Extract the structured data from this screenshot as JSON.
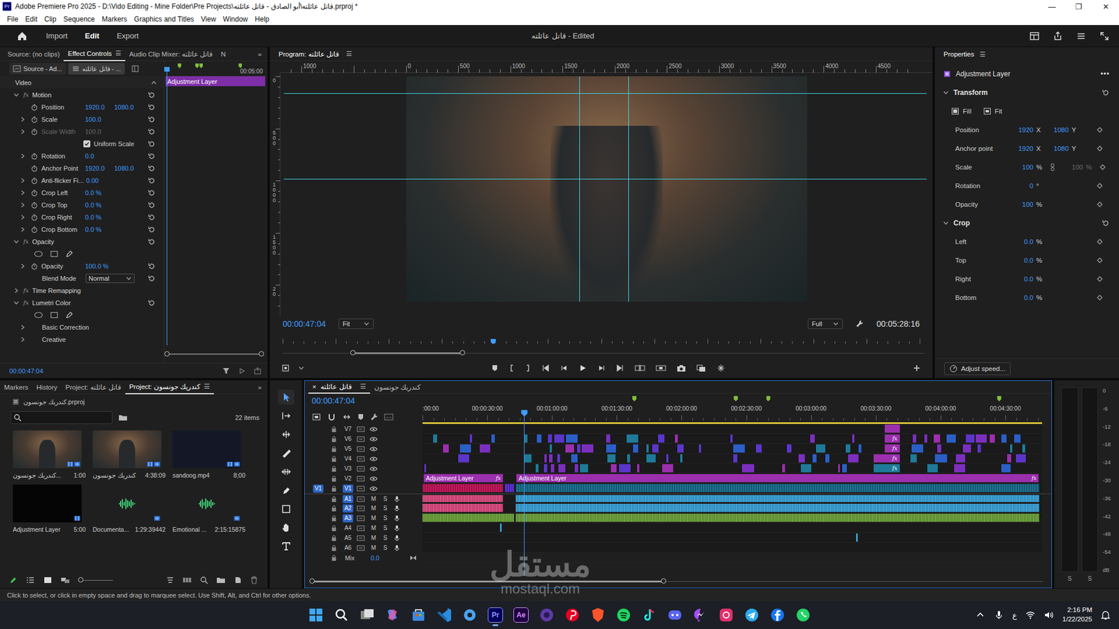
{
  "window": {
    "app_glyph": "Pr",
    "title": "Adobe Premiere Pro 2025 - D:\\Vido Editing - Mine Folder\\Pre Projects\\قاتل عائلته\\أبو الصادق - قاتل عائلته.prproj *",
    "controls": [
      "—",
      "❐",
      "✕"
    ]
  },
  "menu": [
    "File",
    "Edit",
    "Clip",
    "Sequence",
    "Markers",
    "Graphics and Titles",
    "View",
    "Window",
    "Help"
  ],
  "header": {
    "nav": [
      {
        "label": "Import",
        "selected": false
      },
      {
        "label": "Edit",
        "selected": true
      },
      {
        "label": "Export",
        "selected": false
      }
    ],
    "title": "قاتل عائلته - Edited"
  },
  "effect_controls": {
    "tabs": [
      {
        "label": "Source: (no clips)",
        "selected": false
      },
      {
        "label": "Effect Controls",
        "selected": true
      },
      {
        "label": "Audio Clip Mixer: قاتل عائلته",
        "selected": false
      },
      {
        "label": "N",
        "selected": false
      }
    ],
    "tab_menu": "☰",
    "overflow": "»",
    "source": "Source - Ad...",
    "clip": "قاتل عائلته - ...",
    "ruler_time": "00:05:00",
    "clip_label": "Adjustment Layer",
    "markers": [
      0.13,
      0.3,
      0.34,
      0.72
    ],
    "playhead": 0.02,
    "section": "Video",
    "rows": [
      {
        "kind": "group",
        "label": "Motion",
        "fx": "fx",
        "expanded": true,
        "reset": true
      },
      {
        "kind": "param",
        "label": "Position",
        "values": [
          "1920.0",
          "1080.0"
        ],
        "expandable": false,
        "disabled": false,
        "reset": true
      },
      {
        "kind": "param",
        "label": "Scale",
        "values": [
          "100.0"
        ],
        "expandable": true,
        "disabled": false,
        "reset": true
      },
      {
        "kind": "param",
        "label": "Scale Width",
        "values": [
          "100.0"
        ],
        "expandable": true,
        "disabled": true,
        "reset": true
      },
      {
        "kind": "check",
        "label": "Uniform Scale",
        "checked": true,
        "reset": true
      },
      {
        "kind": "param",
        "label": "Rotation",
        "values": [
          "0.0"
        ],
        "expandable": true,
        "disabled": false,
        "reset": true
      },
      {
        "kind": "param",
        "label": "Anchor Point",
        "values": [
          "1920.0",
          "1080.0"
        ],
        "expandable": false,
        "disabled": false,
        "reset": true
      },
      {
        "kind": "param",
        "label": "Anti-flicker Fi...",
        "values": [
          "0.00"
        ],
        "expandable": true,
        "disabled": false,
        "reset": true
      },
      {
        "kind": "param",
        "label": "Crop Left",
        "values": [
          "0.0 %"
        ],
        "expandable": true,
        "disabled": false,
        "reset": true
      },
      {
        "kind": "param",
        "label": "Crop Top",
        "values": [
          "0.0 %"
        ],
        "expandable": true,
        "disabled": false,
        "reset": true
      },
      {
        "kind": "param",
        "label": "Crop Right",
        "values": [
          "0.0 %"
        ],
        "expandable": true,
        "disabled": false,
        "reset": true
      },
      {
        "kind": "param",
        "label": "Crop Bottom",
        "values": [
          "0.0 %"
        ],
        "expandable": true,
        "disabled": false,
        "reset": true
      },
      {
        "kind": "group",
        "label": "Opacity",
        "fx": "fx",
        "expanded": true,
        "reset": true
      },
      {
        "kind": "masks"
      },
      {
        "kind": "param",
        "label": "Opacity",
        "values": [
          "100.0 %"
        ],
        "expandable": true,
        "disabled": false,
        "reset": true
      },
      {
        "kind": "select",
        "label": "Blend Mode",
        "value": "Normal",
        "reset": true
      },
      {
        "kind": "group",
        "label": "Time Remapping",
        "fx": "fx",
        "expanded": false,
        "reset": false
      },
      {
        "kind": "group",
        "label": "Lumetri Color",
        "fx": "fx",
        "expanded": true,
        "reset": true
      },
      {
        "kind": "masks"
      },
      {
        "kind": "sub",
        "label": "Basic Correction",
        "expanded": false
      },
      {
        "kind": "sub",
        "label": "Creative",
        "expanded": false
      }
    ],
    "timecode": "00:00:47:04"
  },
  "program": {
    "title": "Program: قاتل عائلته",
    "menu": "☰",
    "ruler_h": [
      {
        "label": "1000",
        "value": -1000
      },
      {
        "label": "0",
        "value": 0
      },
      {
        "label": "500",
        "value": 500
      },
      {
        "label": "1000",
        "value": 1000
      },
      {
        "label": "1500",
        "value": 1500
      },
      {
        "label": "2000",
        "value": 2000
      },
      {
        "label": "2500",
        "value": 2500
      },
      {
        "label": "3000",
        "value": 3000
      },
      {
        "label": "3500",
        "value": 3500
      },
      {
        "label": "4000",
        "value": 4000
      },
      {
        "label": "4500",
        "value": 4500
      }
    ],
    "ruler_v": [
      {
        "label": "0",
        "value": 0
      },
      {
        "label": "500",
        "value": 500
      },
      {
        "label": "1000",
        "value": 1000
      },
      {
        "label": "1500",
        "value": 1500
      },
      {
        "label": "20",
        "value": 2000
      }
    ],
    "guides_h": [
      164,
      984
    ],
    "guides_v": [
      1660,
      2132
    ],
    "timecode": "00:00:47:04",
    "fit": "Fit",
    "quality": "Full",
    "duration": "00:05:28:16",
    "playhead": 0.33,
    "zoom_start": 0.11,
    "zoom_end": 0.28
  },
  "properties": {
    "title": "Properties",
    "menu": "☰",
    "item": "Adjustment Layer",
    "more": "•••",
    "sections": [
      {
        "title": "Transform",
        "expanded": true,
        "buttons": [
          "Fill",
          "Fit"
        ],
        "rows": [
          {
            "label": "Position",
            "values": [
              {
                "value": "1920",
                "unit": "X",
                "disabled": false
              },
              {
                "value": "1080",
                "unit": "Y",
                "disabled": false
              }
            ],
            "linked": false
          },
          {
            "label": "Anchor point",
            "values": [
              {
                "value": "1920",
                "unit": "X",
                "disabled": false
              },
              {
                "value": "1080",
                "unit": "Y",
                "disabled": false
              }
            ],
            "linked": false
          },
          {
            "label": "Scale",
            "values": [
              {
                "value": "100",
                "unit": "%",
                "disabled": false
              },
              {
                "value": "100",
                "unit": "%",
                "disabled": true
              }
            ],
            "linked": true
          },
          {
            "label": "Rotation",
            "values": [
              {
                "value": "0",
                "unit": "°",
                "disabled": false
              }
            ],
            "linked": false
          },
          {
            "label": "Opacity",
            "values": [
              {
                "value": "100",
                "unit": "%",
                "disabled": false
              }
            ],
            "linked": false
          }
        ]
      },
      {
        "title": "Crop",
        "expanded": true,
        "buttons": [],
        "rows": [
          {
            "label": "Left",
            "values": [
              {
                "value": "0.0",
                "unit": "%",
                "disabled": false
              }
            ],
            "linked": false
          },
          {
            "label": "Top",
            "values": [
              {
                "value": "0.0",
                "unit": "%",
                "disabled": false
              }
            ],
            "linked": false
          },
          {
            "label": "Right",
            "values": [
              {
                "value": "0.0",
                "unit": "%",
                "disabled": false
              }
            ],
            "linked": false
          },
          {
            "label": "Bottom",
            "values": [
              {
                "value": "0.0",
                "unit": "%",
                "disabled": false
              }
            ],
            "linked": false
          }
        ]
      }
    ],
    "adjust": "Adjust speed..."
  },
  "project": {
    "tabs": [
      {
        "label": "Markers",
        "selected": false
      },
      {
        "label": "History",
        "selected": false
      },
      {
        "label": "Project: قاتل عائلته",
        "selected": false
      },
      {
        "label": "Project: كندريك جونسون",
        "selected": true
      }
    ],
    "menu": "☰",
    "overflow": "»",
    "file": "كندريك جونسون.prproj",
    "count": "22 items",
    "items": [
      {
        "name": "كندريك جونسون...",
        "duration": "1:00",
        "kind": "video"
      },
      {
        "name": "كندريك جونسون",
        "duration": "4:38:09",
        "kind": "video"
      },
      {
        "name": "sandoog.mp4",
        "duration": "8;00",
        "kind": "dark"
      },
      {
        "name": "Adjustment Layer",
        "duration": "5:00",
        "kind": "black"
      },
      {
        "name": "Documenta...",
        "duration": "1:29:39442",
        "kind": "audio"
      },
      {
        "name": "Emotional ...",
        "duration": "2:15:15875",
        "kind": "audio"
      }
    ]
  },
  "tools": [
    {
      "kind": "select",
      "selected": true
    },
    {
      "kind": "track",
      "selected": false
    },
    {
      "kind": "ripple",
      "selected": false
    },
    {
      "kind": "razor",
      "selected": false
    },
    {
      "kind": "slip",
      "selected": false
    },
    {
      "kind": "pen",
      "selected": false
    },
    {
      "kind": "rect",
      "selected": false
    },
    {
      "kind": "hand",
      "selected": false
    },
    {
      "kind": "type",
      "selected": false
    }
  ],
  "timeline": {
    "tabs": [
      {
        "label": "قاتل عائلته",
        "selected": true
      },
      {
        "label": "كندريك جونسون",
        "selected": false
      }
    ],
    "close": "×",
    "menu": "☰",
    "timecode": "00:00:47:04",
    "ruler": [
      {
        "label": ":00:00",
        "s": 0
      },
      {
        "label": "00:00:30:00",
        "s": 30
      },
      {
        "label": "00:01:00:00",
        "s": 60
      },
      {
        "label": "00:01:30:00",
        "s": 90
      },
      {
        "label": "00:02:00:00",
        "s": 120
      },
      {
        "label": "00:02:30:00",
        "s": 150
      },
      {
        "label": "00:03:00:00",
        "s": 180
      },
      {
        "label": "00:03:30:00",
        "s": 210
      },
      {
        "label": "00:04:00:00",
        "s": 240
      },
      {
        "label": "00:04:30:00",
        "s": 270
      }
    ],
    "markers": [
      98,
      145,
      160,
      267
    ],
    "playhead": 47.07,
    "mute_label": "M",
    "solo_label": "S",
    "scroll_start": 0.01,
    "scroll_end": 0.48,
    "tracks": [
      {
        "name": "V7",
        "kind": "video",
        "targeted": false,
        "clips": [
          {
            "start": 214,
            "end": 221,
            "kind": "fx",
            "color": "#9b2fae"
          }
        ]
      },
      {
        "name": "V6",
        "kind": "video",
        "targeted": false,
        "clips": [
          {
            "start": 214,
            "end": 221,
            "kind": "fx",
            "fx": "fx",
            "color": "#9b2fae"
          }
        ]
      },
      {
        "name": "V5",
        "kind": "video",
        "targeted": false,
        "clips": [
          {
            "start": 214,
            "end": 221,
            "kind": "fx",
            "fx": "fx",
            "color": "#9b2fae"
          }
        ]
      },
      {
        "name": "V4",
        "kind": "video",
        "targeted": false,
        "clips": [
          {
            "start": 209,
            "end": 221,
            "kind": "fx",
            "fx": "fx",
            "color": "#9b2fae"
          }
        ]
      },
      {
        "name": "V3",
        "kind": "video",
        "targeted": false,
        "clips": [
          {
            "start": 209,
            "end": 221,
            "kind": "fx",
            "fx": "fx",
            "color": "#1f7a99"
          }
        ]
      },
      {
        "name": "V2",
        "kind": "video",
        "targeted": false,
        "clips": [
          {
            "start": 0.5,
            "end": 37.3,
            "kind": "adjustment",
            "label": "Adjustment Layer",
            "fx": "fx",
            "color": "#9b2fae"
          },
          {
            "start": 43.5,
            "end": 285.5,
            "kind": "adjustment",
            "label": "Adjustment Layer",
            "fx": "fx",
            "color": "#9b2fae"
          }
        ]
      },
      {
        "name": "V1",
        "kind": "video",
        "targeted": true,
        "source": "V1",
        "clips": [
          {
            "start": 0,
            "end": 37.3,
            "kind": "video",
            "color": "#c2185b"
          },
          {
            "start": 38,
            "end": 42.3,
            "kind": "video",
            "color": "#5b2fd0"
          },
          {
            "start": 43.3,
            "end": 285.7,
            "kind": "video",
            "color": "#1d6f8f"
          }
        ]
      },
      {
        "name": "A1",
        "kind": "audio",
        "targeted": true,
        "clips": [
          {
            "start": 0,
            "end": 37.3,
            "kind": "audio",
            "color": "#c93a6e"
          },
          {
            "start": 43.3,
            "end": 285.7,
            "kind": "audio",
            "color": "#2a8fc4"
          }
        ]
      },
      {
        "name": "A2",
        "kind": "audio",
        "targeted": true,
        "clips": [
          {
            "start": 0,
            "end": 37.3,
            "kind": "audio",
            "color": "#c93a6e"
          },
          {
            "start": 43.3,
            "end": 285.7,
            "kind": "audio",
            "color": "#2a8fc4"
          }
        ]
      },
      {
        "name": "A3",
        "kind": "audio",
        "targeted": true,
        "clips": [
          {
            "start": 0,
            "end": 42.3,
            "kind": "audio",
            "color": "#5b8f2a"
          },
          {
            "start": 43.3,
            "end": 285.7,
            "kind": "audio",
            "color": "#5b8f2a"
          }
        ]
      },
      {
        "name": "A4",
        "kind": "audio",
        "targeted": false,
        "clips": [
          {
            "start": 36,
            "end": 36.7,
            "kind": "audio",
            "color": "#2a8fc4"
          }
        ]
      },
      {
        "name": "A5",
        "kind": "audio",
        "targeted": false,
        "clips": [
          {
            "start": 201,
            "end": 201.6,
            "kind": "audio",
            "color": "#2a8fc4"
          }
        ]
      },
      {
        "name": "A6",
        "kind": "audio",
        "targeted": false,
        "clips": []
      }
    ],
    "mix": {
      "label": "Mix",
      "value": "0.0"
    }
  },
  "meter": {
    "scale": [
      "0",
      "-6",
      "-12",
      "-18",
      "-24",
      "-30",
      "-36",
      "-42",
      "-48",
      "-54",
      "dB"
    ],
    "channels": [
      {
        "label": "S",
        "level": 0
      },
      {
        "label": "S",
        "level": 0
      }
    ]
  },
  "status_bar": "Click to select, or click in empty space and drag to marquee select. Use Shift, Alt, and Ctrl for other options.",
  "watermark": {
    "arabic": "مستقل",
    "latin": "mostaql.com"
  },
  "taskbar": {
    "apps": [
      {
        "kind": "start",
        "running": false
      },
      {
        "kind": "search",
        "running": false
      },
      {
        "kind": "taskview",
        "running": false
      },
      {
        "kind": "copilot",
        "running": false
      },
      {
        "kind": "store",
        "running": false
      },
      {
        "kind": "vscode",
        "running": false
      },
      {
        "kind": "settings",
        "running": false
      },
      {
        "kind": "premiere",
        "glyph": "Pr",
        "running": true
      },
      {
        "kind": "aftereffects",
        "glyph": "Ae",
        "running": false
      },
      {
        "kind": "obs",
        "running": false
      },
      {
        "kind": "pinterest",
        "running": false
      },
      {
        "kind": "brave",
        "running": false
      },
      {
        "kind": "spotify",
        "running": false
      },
      {
        "kind": "tiktok",
        "running": false
      },
      {
        "kind": "discord",
        "running": false
      },
      {
        "kind": "messenger",
        "running": false
      },
      {
        "kind": "instagram",
        "running": false
      },
      {
        "kind": "telegram",
        "running": false
      },
      {
        "kind": "facebook",
        "running": false
      },
      {
        "kind": "whatsapp",
        "running": false
      }
    ],
    "tray": {
      "lang": "ع",
      "time": "2:16 PM",
      "date": "1/22/2025"
    }
  }
}
